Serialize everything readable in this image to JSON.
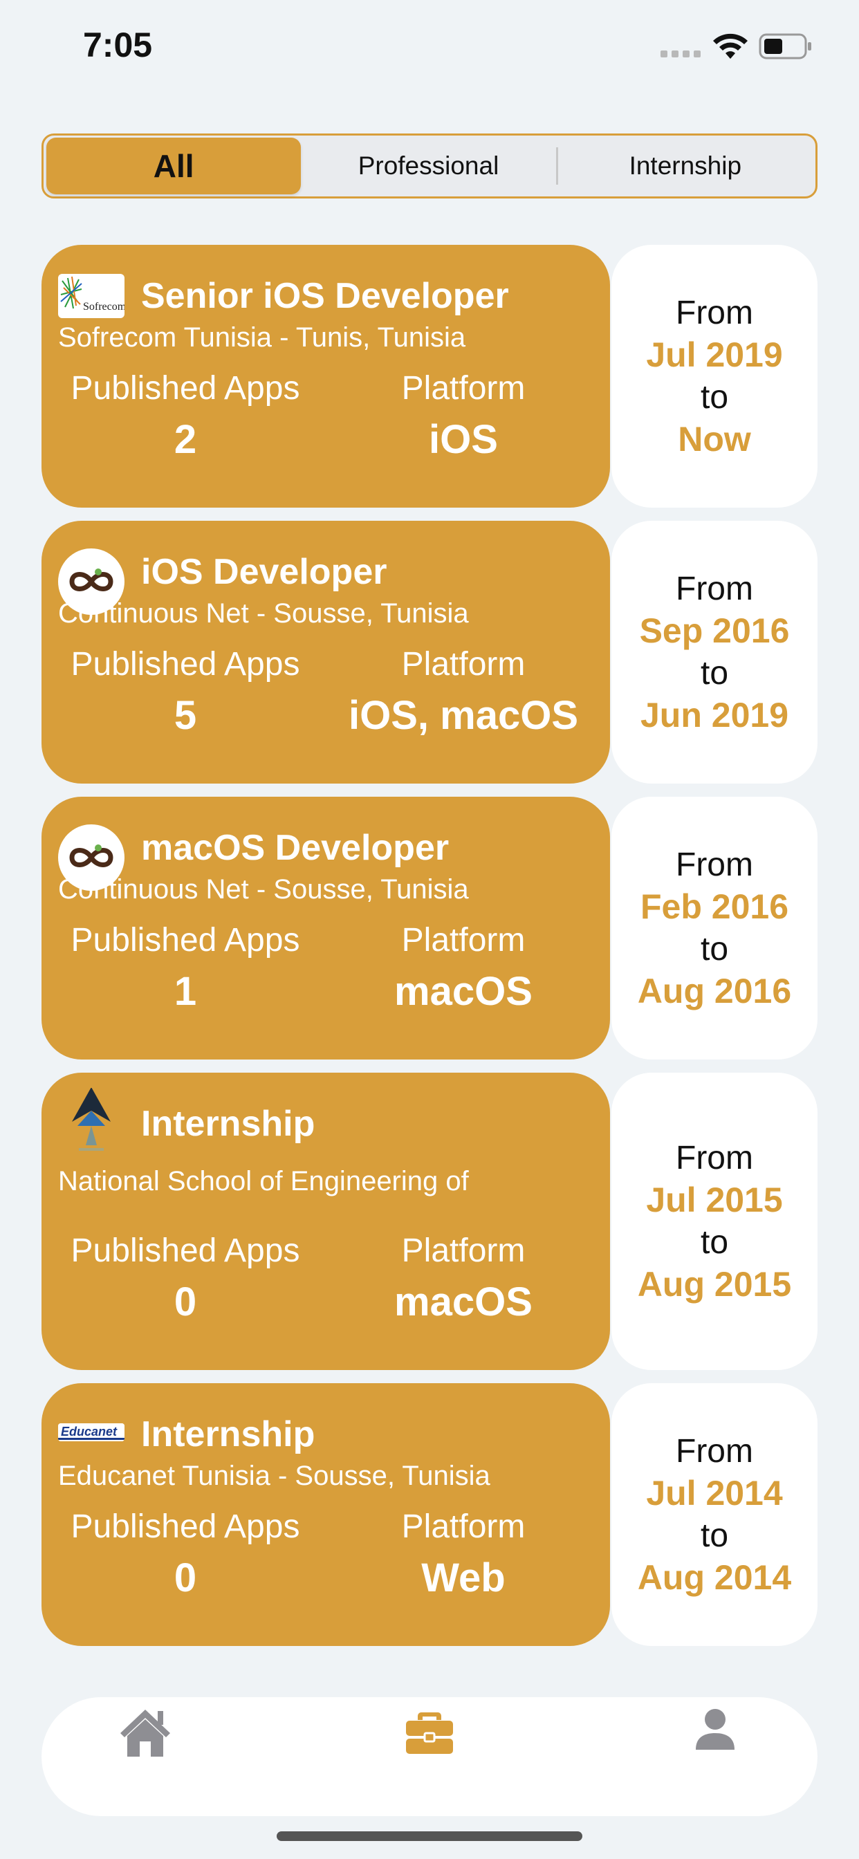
{
  "status_bar": {
    "time": "7:05"
  },
  "segments": [
    {
      "label": "All",
      "selected": true
    },
    {
      "label": "Professional",
      "selected": false
    },
    {
      "label": "Internship",
      "selected": false
    }
  ],
  "experience": [
    {
      "title": "Senior iOS Developer",
      "company": "Sofrecom Tunisia - Tunis, Tunisia",
      "logo": "sofrecom-logo",
      "logo_text": "Sofrecom",
      "apps_label": "Published Apps",
      "apps_value": "2",
      "platform_label": "Platform",
      "platform_value": "iOS",
      "from_label": "From",
      "from": "Jul 2019",
      "to_label": "to",
      "to": "Now"
    },
    {
      "title": "iOS Developer",
      "company": "Continuous Net - Sousse, Tunisia",
      "logo": "continuous-net-logo",
      "apps_label": "Published Apps",
      "apps_value": "5",
      "platform_label": "Platform",
      "platform_value": "iOS, macOS",
      "from_label": "From",
      "from": "Sep 2016",
      "to_label": "to",
      "to": "Jun 2019"
    },
    {
      "title": "macOS Developer",
      "company": "Continuous Net - Sousse, Tunisia",
      "logo": "continuous-net-logo",
      "apps_label": "Published Apps",
      "apps_value": "1",
      "platform_label": "Platform",
      "platform_value": "macOS",
      "from_label": "From",
      "from": "Feb 2016",
      "to_label": "to",
      "to": "Aug 2016"
    },
    {
      "title": "Internship",
      "company": "National School of Engineering of",
      "logo": "engineering-school-logo",
      "apps_label": "Published Apps",
      "apps_value": "0",
      "platform_label": "Platform",
      "platform_value": "macOS",
      "from_label": "From",
      "from": "Jul 2015",
      "to_label": "to",
      "to": "Aug 2015"
    },
    {
      "title": "Internship",
      "company": "Educanet Tunisia - Sousse, Tunisia",
      "logo": "educanet-logo",
      "logo_text": "Educanet",
      "apps_label": "Published Apps",
      "apps_value": "0",
      "platform_label": "Platform",
      "platform_value": "Web",
      "from_label": "From",
      "from": "Jul 2014",
      "to_label": "to",
      "to": "Aug 2014"
    }
  ],
  "tab_bar": [
    {
      "icon": "house-icon",
      "selected": false
    },
    {
      "icon": "briefcase-icon",
      "selected": true
    },
    {
      "icon": "person-icon",
      "selected": false
    }
  ],
  "colors": {
    "accent": "#D89E3A",
    "background": "#EFF3F6",
    "card": "#FFFFFF",
    "tab_inactive": "#8E8E93"
  }
}
